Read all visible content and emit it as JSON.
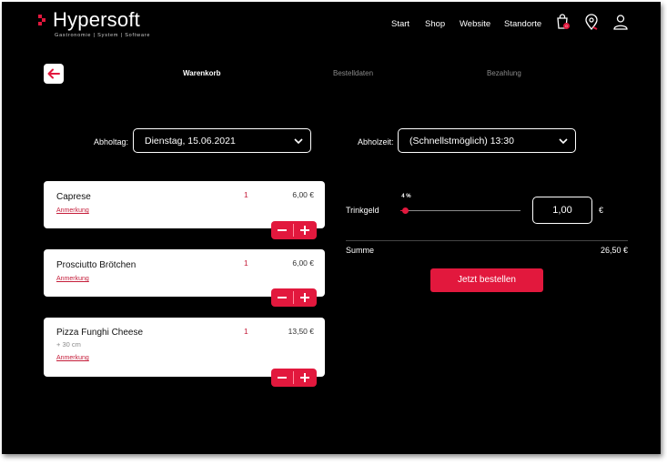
{
  "brand": {
    "name": "Hypersoft",
    "tagline": "Gastronomie | System | Software"
  },
  "nav": {
    "items": [
      "Start",
      "Shop",
      "Website",
      "Standorte"
    ],
    "cart_badge": "0"
  },
  "steps": [
    {
      "label": "Warenkorb",
      "active": true
    },
    {
      "label": "Bestelldaten",
      "active": false
    },
    {
      "label": "Bezahlung",
      "active": false
    }
  ],
  "pickup": {
    "day_label": "Abholtag:",
    "day_value": "Dienstag, 15.06.2021",
    "time_label": "Abholzeit:",
    "time_value": "(Schnellstmöglich) 13:30"
  },
  "cart": [
    {
      "name": "Caprese",
      "qty": "1",
      "price": "6,00 €",
      "note": "Anmerkung",
      "extra": ""
    },
    {
      "name": "Prosciutto Brötchen",
      "qty": "1",
      "price": "6,00 €",
      "note": "Anmerkung",
      "extra": ""
    },
    {
      "name": "Pizza Funghi Cheese",
      "qty": "1",
      "price": "13,50 €",
      "note": "Anmerkung",
      "extra": "+ 30 cm"
    }
  ],
  "tip": {
    "label": "Trinkgeld",
    "percent_label": "4 %",
    "percent": 4,
    "value": "1,00",
    "currency": "€"
  },
  "summary": {
    "label": "Summe",
    "value": "26,50 €"
  },
  "order_button": "Jetzt bestellen",
  "colors": {
    "accent": "#e2183d",
    "background": "#000000"
  }
}
